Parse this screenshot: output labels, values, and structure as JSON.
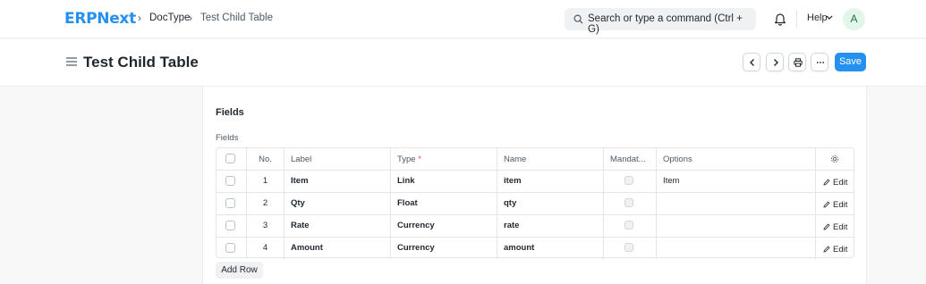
{
  "navbar": {
    "logo": "ERPNext",
    "breadcrumbs": [
      "DocType",
      "Test Child Table"
    ],
    "search_placeholder": "Search or type a command (Ctrl + G)",
    "help_label": "Help",
    "avatar_initial": "A"
  },
  "page": {
    "title": "Test Child Table",
    "save_label": "Save"
  },
  "form": {
    "section_title": "Fields",
    "field_label": "Fields",
    "add_row_label": "Add Row",
    "table": {
      "columns": [
        "No.",
        "Label",
        "Type",
        "Name",
        "Mandat...",
        "Options"
      ],
      "required_marker": "*",
      "edit_label": "Edit",
      "rows": [
        {
          "no": "1",
          "label": "Item",
          "type": "Link",
          "name": "item",
          "mandatory": false,
          "options": "Item"
        },
        {
          "no": "2",
          "label": "Qty",
          "type": "Float",
          "name": "qty",
          "mandatory": false,
          "options": ""
        },
        {
          "no": "3",
          "label": "Rate",
          "type": "Currency",
          "name": "rate",
          "mandatory": false,
          "options": ""
        },
        {
          "no": "4",
          "label": "Amount",
          "type": "Currency",
          "name": "amount",
          "mandatory": false,
          "options": ""
        }
      ]
    }
  },
  "colors": {
    "brand": "#2490ef",
    "required": "#e24c4c"
  }
}
